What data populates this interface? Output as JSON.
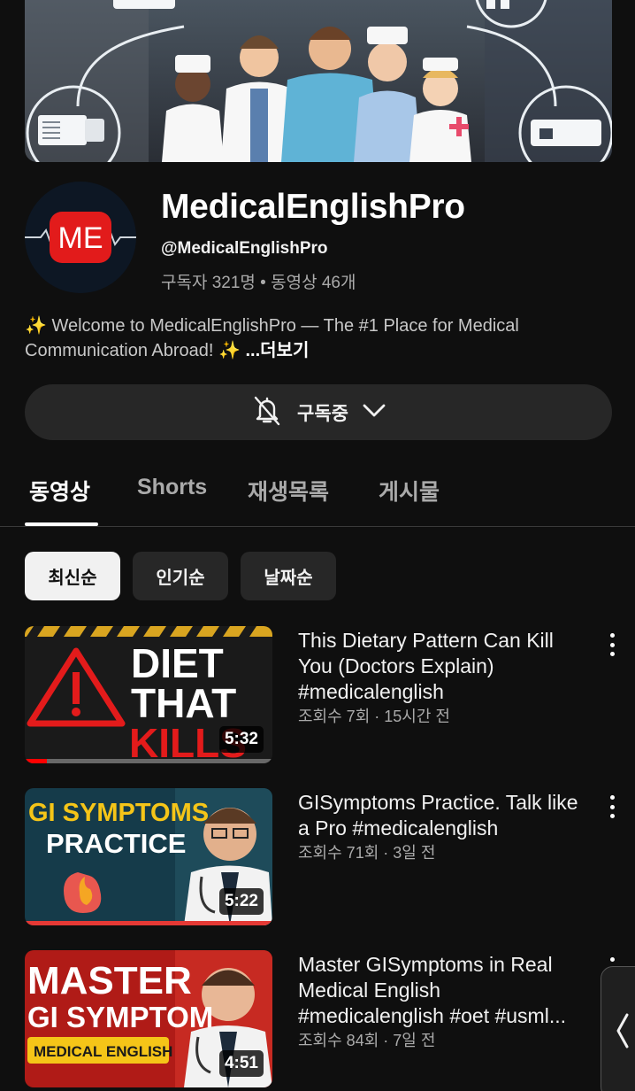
{
  "channel": {
    "name": "MedicalEnglishPro",
    "handle": "@MedicalEnglishPro",
    "stats": "구독자 321명 • 동영상 46개",
    "avatar_text": "ME",
    "description": "✨ Welcome to MedicalEnglishPro — The #1 Place for Medical Communication Abroad! ✨ ",
    "more_label": "...더보기"
  },
  "subscribe": {
    "label": "구독중",
    "icon": "bell-off-icon"
  },
  "tabs": [
    {
      "label": "동영상",
      "active": true
    },
    {
      "label": "Shorts",
      "active": false
    },
    {
      "label": "재생목록",
      "active": false
    },
    {
      "label": "게시물",
      "active": false
    }
  ],
  "chips": [
    {
      "label": "최신순",
      "active": true
    },
    {
      "label": "인기순",
      "active": false
    },
    {
      "label": "날짜순",
      "active": false
    }
  ],
  "videos": [
    {
      "title": "  This Dietary Pattern  Can Kill You (Doctors Explain) #medicalenglish",
      "meta": "조회수 7회 · 15시간 전",
      "duration": "5:32",
      "watched_fraction": 0.09,
      "thumb": {
        "line1": "DIET",
        "line2": "THAT",
        "line3": "KILLS"
      }
    },
    {
      "title": "GISymptoms Practice. Talk like a Pro #medicalenglish",
      "meta": "조회수 71회 · 3일 전",
      "duration": "5:22",
      "watched_fraction": 0,
      "thumb": {
        "line1": "GI SYMPTOMS",
        "line2": "PRACTICE"
      }
    },
    {
      "title": "Master GISymptoms in Real Medical English #medicalenglish #oet #usml...",
      "meta": "조회수 84회 · 7일 전",
      "duration": "4:51",
      "watched_fraction": 0,
      "thumb": {
        "line1": "MASTER",
        "line2": "GI SYMPTOM",
        "line3": "MEDICAL ENGLISH"
      }
    }
  ],
  "colors": {
    "background": "#0f0f0f",
    "accent_red": "#ff0000",
    "chip_bg": "#272727"
  }
}
